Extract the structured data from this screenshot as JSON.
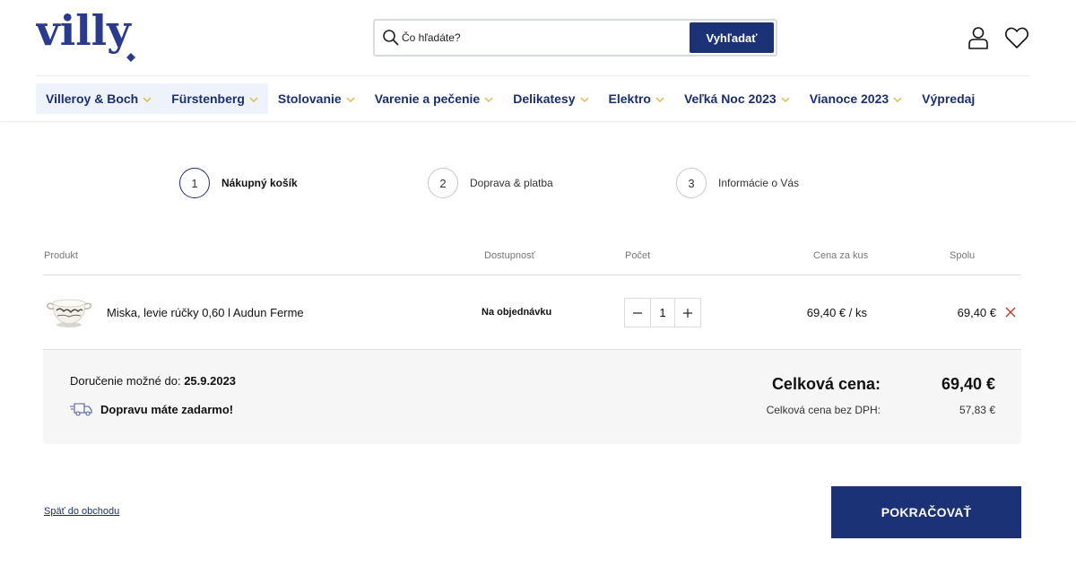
{
  "brand": {
    "logo_text": "villy",
    "color": "#2a3a8f",
    "accent": "#e6b84a"
  },
  "search": {
    "placeholder": "Čo hľadáte?",
    "button": "Vyhľadať"
  },
  "nav": [
    {
      "label": "Villeroy & Boch",
      "dropdown": true,
      "highlight": true
    },
    {
      "label": "Fürstenberg",
      "dropdown": true,
      "highlight": true
    },
    {
      "label": "Stolovanie",
      "dropdown": true
    },
    {
      "label": "Varenie a pečenie",
      "dropdown": true
    },
    {
      "label": "Delikatesy",
      "dropdown": true
    },
    {
      "label": "Elektro",
      "dropdown": true
    },
    {
      "label": "Veľká Noc 2023",
      "dropdown": true
    },
    {
      "label": "Vianoce 2023",
      "dropdown": true
    },
    {
      "label": "Výpredaj",
      "dropdown": false
    }
  ],
  "steps": [
    {
      "number": "1",
      "label": "Nákupný košík",
      "active": true
    },
    {
      "number": "2",
      "label": "Doprava & platba",
      "active": false
    },
    {
      "number": "3",
      "label": "Informácie o Vás",
      "active": false
    }
  ],
  "table": {
    "headers": {
      "product": "Produkt",
      "availability": "Dostupnosť",
      "quantity": "Počet",
      "unit_price": "Cena za kus",
      "total": "Spolu"
    },
    "rows": [
      {
        "name": "Miska, levie rúčky 0,60 l Audun Ferme",
        "availability": "Na objednávku",
        "quantity": "1",
        "unit_price": "69,40 € / ks",
        "total": "69,40 €"
      }
    ]
  },
  "summary": {
    "delivery_label": "Doručenie možné do:",
    "delivery_date": "25.9.2023",
    "free_shipping": "Dopravu máte zadarmo!",
    "total_label": "Celková cena:",
    "total_value": "69,40 €",
    "net_label": "Celková cena bez DPH:",
    "net_value": "57,83 €"
  },
  "actions": {
    "back": "Späť do obchodu",
    "continue": "POKRAČOVAŤ"
  }
}
